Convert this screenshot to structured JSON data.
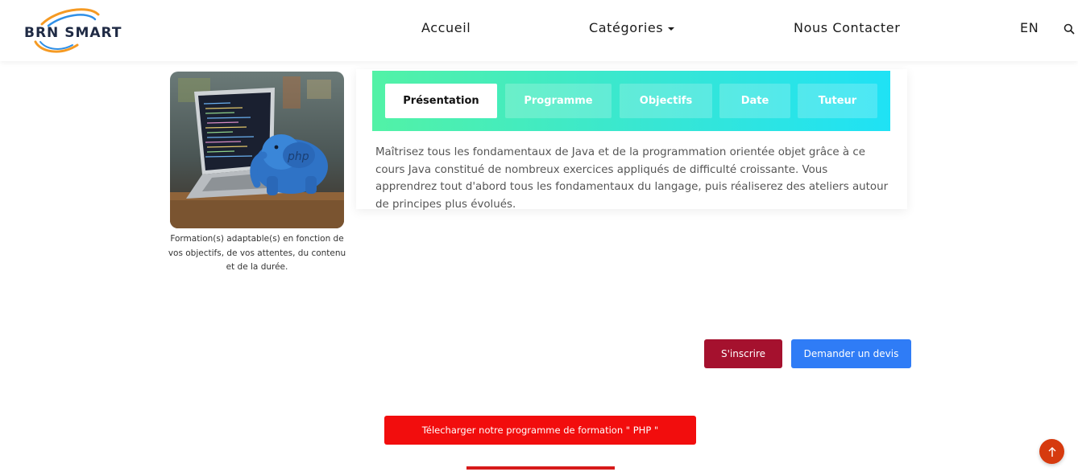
{
  "header": {
    "logo_text": "BRN SMART",
    "nav": {
      "home": "Accueil",
      "categories": "Catégories",
      "contact": "Nous Contacter",
      "language": "EN"
    }
  },
  "course": {
    "image_alt": "php",
    "image_caption": "Formation(s) adaptable(s) en fonction de vos objectifs, de vos attentes, du contenu et de la durée.",
    "tabs": [
      "Présentation",
      "Programme",
      "Objectifs",
      "Date",
      "Tuteur"
    ],
    "active_tab": "Présentation",
    "description": "Maîtrisez tous les fondamentaux de Java et de la programmation orientée objet grâce à ce cours Java constitué de nombreux exercices appliqués de difficulté croissante. Vous apprendrez tout d'abord tous les fondamentaux du langage, puis réaliserez des ateliers autour de principes plus évolués."
  },
  "actions": {
    "signup": "S'inscrire",
    "quote": "Demander un devis",
    "download": "Télecharger notre programme de formation \" PHP \""
  },
  "icons": {
    "search": "search-icon",
    "caret": "caret-down-icon",
    "scroll_top": "arrow-up-icon"
  },
  "colors": {
    "signup": "#a5112e",
    "quote": "#2f7cf6",
    "download": "#f20d0d",
    "scroll_top": "#d63a0e",
    "tab_gradient_start": "#52f2a6",
    "tab_gradient_end": "#1fe2f5"
  }
}
